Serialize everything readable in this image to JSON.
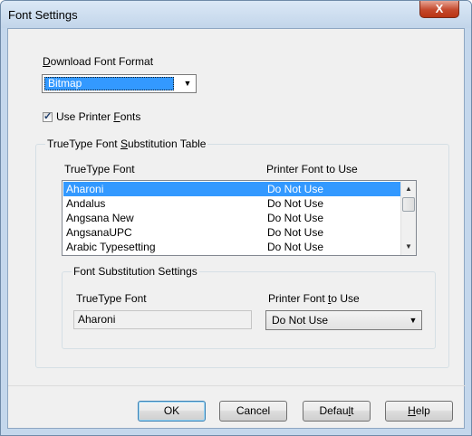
{
  "window": {
    "title": "Font Settings",
    "close_glyph": "X"
  },
  "download": {
    "label_pre": "",
    "label_key": "D",
    "label_post": "ownload Font Format",
    "combo_value": "Bitmap",
    "arrow_glyph": "▼"
  },
  "printer_fonts": {
    "checked": true,
    "check_glyph": "✓",
    "label_pre": "Use Printer ",
    "label_key": "F",
    "label_post": "onts"
  },
  "table_group": {
    "title_pre": "TrueType Font ",
    "title_key": "S",
    "title_post": "ubstitution Table",
    "col1": "TrueType Font",
    "col2": "Printer Font to Use",
    "rows": [
      {
        "font": "Aharoni",
        "printer": "Do Not Use",
        "selected": true
      },
      {
        "font": "Andalus",
        "printer": "Do Not Use"
      },
      {
        "font": "Angsana New",
        "printer": "Do Not Use"
      },
      {
        "font": "AngsanaUPC",
        "printer": "Do Not Use"
      },
      {
        "font": "Arabic Typesetting",
        "printer": "Do Not Use"
      }
    ],
    "scroll_up_glyph": "▲",
    "scroll_down_glyph": "▼"
  },
  "settings_group": {
    "title": "Font Substitution Settings",
    "tt_label": "TrueType Font",
    "tt_value": "Aharoni",
    "pf_label_pre": "Printer Font ",
    "pf_label_key": "t",
    "pf_label_post": "o Use",
    "pf_value": "Do Not Use",
    "arrow_glyph": "▼"
  },
  "buttons": {
    "ok": "OK",
    "cancel": "Cancel",
    "default_pre": "Defau",
    "default_key": "l",
    "default_post": "t",
    "help_pre": "",
    "help_key": "H",
    "help_post": "elp"
  },
  "colors": {
    "selection": "#3399ff",
    "accent_border": "#3c7fb1",
    "close": "#c4482c"
  }
}
